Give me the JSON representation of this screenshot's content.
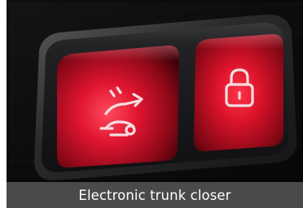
{
  "photo": {
    "subject": "Two illuminated red buttons on a car trunk panel",
    "left_button": {
      "icon": "trunk-close-arrow-icon",
      "glow_color": "#e01530"
    },
    "right_button": {
      "icon": "padlock-icon",
      "glow_color": "#e01530"
    },
    "housing_color": "#1a1a1b",
    "panel_color": "#0e0e10"
  },
  "caption": {
    "text": "Electronic trunk closer",
    "background": "#4a4a4a",
    "color": "#ffffff"
  }
}
